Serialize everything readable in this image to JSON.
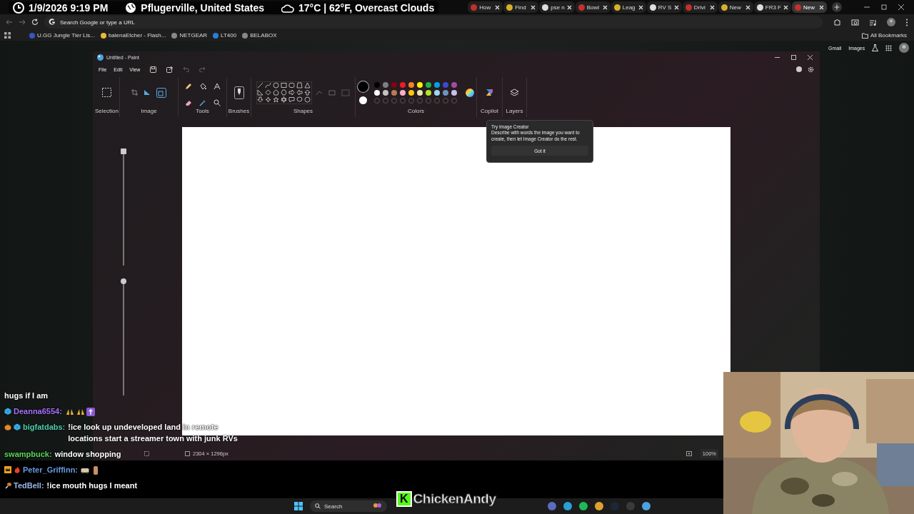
{
  "stream_overlay": {
    "datetime": "1/9/2026 9:19 PM",
    "location": "Pflugerville, United States",
    "weather": "17°C | 62°F, Overcast Clouds"
  },
  "browser": {
    "tabs": [
      {
        "label": "How",
        "selected": false
      },
      {
        "label": "Find",
        "selected": false
      },
      {
        "label": "pse n",
        "selected": false
      },
      {
        "label": "Bowl",
        "selected": false
      },
      {
        "label": "Leag",
        "selected": false
      },
      {
        "label": "RV S",
        "selected": false
      },
      {
        "label": "Drivi",
        "selected": false
      },
      {
        "label": "New",
        "selected": false
      },
      {
        "label": "FR3 F",
        "selected": false
      },
      {
        "label": "New",
        "selected": true
      }
    ],
    "address": {
      "placeholder": "Search Google or type a URL"
    },
    "bookmarks": [
      "U.GG Jungle Tier Lis...",
      "balenaEtcher - Flash...",
      "NETGEAR",
      "LT400",
      "BELABOX"
    ],
    "all_bookmarks": "All Bookmarks",
    "ntp_links": [
      "Gmail",
      "Images"
    ]
  },
  "paint": {
    "title": "Untitled - Paint",
    "menu": [
      "File",
      "Edit",
      "View"
    ],
    "groups": [
      "Selection",
      "Image",
      "Tools",
      "Brushes",
      "Shapes",
      "Colors",
      "Copilot",
      "Layers"
    ],
    "current_colors": [
      {
        "color": "#000000",
        "selected": true
      },
      {
        "color": "#ffffff",
        "selected": false
      }
    ],
    "palette": [
      {
        "color": "#000000"
      },
      {
        "color": "#7f7f7f"
      },
      {
        "color": "#880015"
      },
      {
        "color": "#ed1c24"
      },
      {
        "color": "#ff7f27"
      },
      {
        "color": "#fff200"
      },
      {
        "color": "#22b14c"
      },
      {
        "color": "#00a2e8"
      },
      {
        "color": "#3f48cc"
      },
      {
        "color": "#a349a4"
      },
      {
        "color": "#ffffff"
      },
      {
        "color": "#c3c3c3"
      },
      {
        "color": "#b97a57"
      },
      {
        "color": "#ffaec9"
      },
      {
        "color": "#ffc90e"
      },
      {
        "color": "#efe4b0"
      },
      {
        "color": "#b5e61d"
      },
      {
        "color": "#99d9ea"
      },
      {
        "color": "#7092be"
      },
      {
        "color": "#c8bfe7"
      }
    ],
    "sliders": [
      {
        "level": 1
      },
      {
        "level": 1
      }
    ],
    "popup": {
      "title": "Try Image Creator",
      "text": "Describe with words the image you want to create, then let Image Creator do the rest.",
      "button": "Got it"
    },
    "status": {
      "canvas_size": "2304 × 1296px",
      "zoom": "100%"
    }
  },
  "chat": [
    {
      "kind": "continuation",
      "text": "hugs if I am"
    },
    {
      "kind": "message",
      "badges": [
        {
          "kind": "cube"
        }
      ],
      "user": "Deanna6554:",
      "color": "#a970ff",
      "emotes": [
        {
          "kind": "hands"
        },
        {
          "kind": "hands"
        },
        {
          "kind": "cross"
        }
      ]
    },
    {
      "kind": "message",
      "badges": [
        {
          "kind": "pumpkin"
        },
        {
          "kind": "cube"
        }
      ],
      "user": "bigfatdabs:",
      "color": "#4fd1b0",
      "text": "!ice look up undeveloped land in remote locations start a streamer town with junk RVs"
    },
    {
      "kind": "message",
      "user": "swampbuck:",
      "color": "#5cd65c",
      "text": "window shopping"
    },
    {
      "kind": "message",
      "badges": [
        {
          "kind": "crown"
        },
        {
          "kind": "flame"
        }
      ],
      "user": "Peter_Griffinn:",
      "color": "#6a9be0",
      "emotes": [
        {
          "kind": "rv"
        },
        {
          "kind": "figure"
        }
      ]
    },
    {
      "kind": "message",
      "badges": [
        {
          "kind": "drumstick"
        }
      ],
      "user": "TedBell:",
      "color": "#9ab7e8",
      "text": "!ice mouth hugs I meant"
    }
  ],
  "streamer_tag": {
    "logo": "K",
    "name": "ChickenAndy"
  },
  "taskbar": {
    "search": {
      "placeholder": "Search"
    }
  }
}
